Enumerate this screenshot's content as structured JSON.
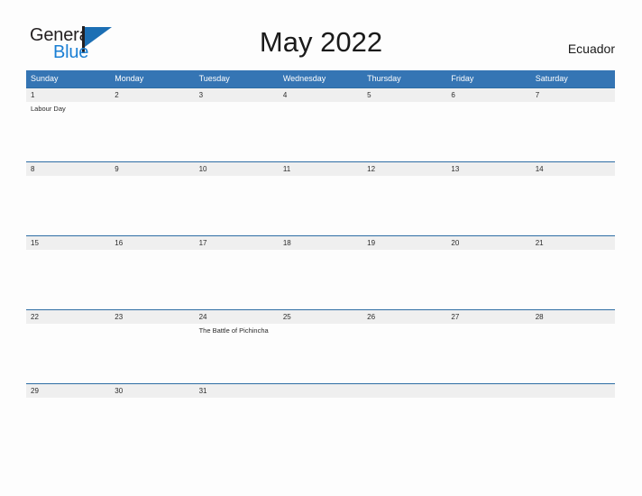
{
  "logo": {
    "word_one": "General",
    "word_two": "Blue",
    "flag_icon": "flag-triangle-icon",
    "color_dark": "#231f20",
    "color_blue": "#1a7fd4"
  },
  "header": {
    "title": "May 2022",
    "country": "Ecuador"
  },
  "colors": {
    "header_blue": "#3575b4",
    "row_divider_blue": "#2e6da4",
    "date_band_gray": "#efefef",
    "page_background": "#fdfdfd",
    "text_dark": "#2b2b2b"
  },
  "calendar": {
    "weekdays": [
      "Sunday",
      "Monday",
      "Tuesday",
      "Wednesday",
      "Thursday",
      "Friday",
      "Saturday"
    ],
    "weeks": [
      {
        "days": [
          {
            "date": "1",
            "event": "Labour Day"
          },
          {
            "date": "2",
            "event": ""
          },
          {
            "date": "3",
            "event": ""
          },
          {
            "date": "4",
            "event": ""
          },
          {
            "date": "5",
            "event": ""
          },
          {
            "date": "6",
            "event": ""
          },
          {
            "date": "7",
            "event": ""
          }
        ]
      },
      {
        "days": [
          {
            "date": "8",
            "event": ""
          },
          {
            "date": "9",
            "event": ""
          },
          {
            "date": "10",
            "event": ""
          },
          {
            "date": "11",
            "event": ""
          },
          {
            "date": "12",
            "event": ""
          },
          {
            "date": "13",
            "event": ""
          },
          {
            "date": "14",
            "event": ""
          }
        ]
      },
      {
        "days": [
          {
            "date": "15",
            "event": ""
          },
          {
            "date": "16",
            "event": ""
          },
          {
            "date": "17",
            "event": ""
          },
          {
            "date": "18",
            "event": ""
          },
          {
            "date": "19",
            "event": ""
          },
          {
            "date": "20",
            "event": ""
          },
          {
            "date": "21",
            "event": ""
          }
        ]
      },
      {
        "days": [
          {
            "date": "22",
            "event": ""
          },
          {
            "date": "23",
            "event": ""
          },
          {
            "date": "24",
            "event": "The Battle of Pichincha"
          },
          {
            "date": "25",
            "event": ""
          },
          {
            "date": "26",
            "event": ""
          },
          {
            "date": "27",
            "event": ""
          },
          {
            "date": "28",
            "event": ""
          }
        ]
      },
      {
        "days": [
          {
            "date": "29",
            "event": ""
          },
          {
            "date": "30",
            "event": ""
          },
          {
            "date": "31",
            "event": ""
          },
          {
            "date": "",
            "event": ""
          },
          {
            "date": "",
            "event": ""
          },
          {
            "date": "",
            "event": ""
          },
          {
            "date": "",
            "event": ""
          }
        ]
      }
    ]
  }
}
